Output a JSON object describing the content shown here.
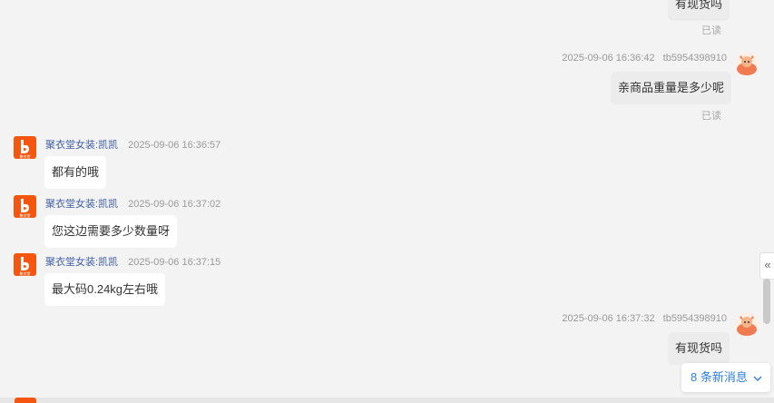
{
  "messages": {
    "top_bubble": "有现货吗",
    "top_read": "已读",
    "msg1": {
      "timestamp": "2025-09-06 16:36:42",
      "user": "tb5954398910",
      "text": "亲商品重量是多少呢",
      "read": "已读"
    },
    "msg2": {
      "sender": "聚衣堂女装:凯凯",
      "timestamp": "2025-09-06 16:36:57",
      "text": "都有的哦"
    },
    "msg3": {
      "sender": "聚衣堂女装:凯凯",
      "timestamp": "2025-09-06 16:37:02",
      "text": "您这边需要多少数量呀"
    },
    "msg4": {
      "sender": "聚衣堂女装:凯凯",
      "timestamp": "2025-09-06 16:37:15",
      "text": "最大码0.24kg左右哦"
    },
    "msg5": {
      "timestamp": "2025-09-06 16:37:32",
      "user": "tb5954398910",
      "text": "有现货吗"
    }
  },
  "shop_avatar_label": "聚衣堂",
  "collapse_icon": "«",
  "new_messages": {
    "label": "8 条新消息",
    "icon": "chevron-down-icon"
  },
  "colors": {
    "shop_brand": "#f4550f",
    "link_blue": "#2d7fe0",
    "sender_name": "#3f5fa6"
  }
}
